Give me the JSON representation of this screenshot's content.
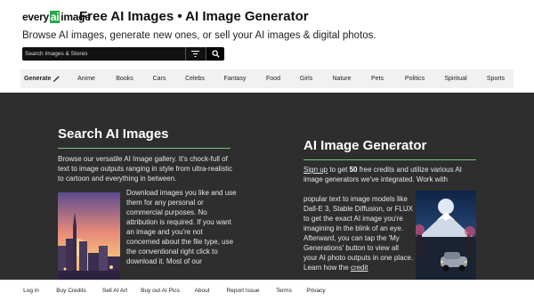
{
  "header": {
    "logo_part1": "every",
    "logo_part2": "ai",
    "logo_part3": "image",
    "title": "Free AI Images • AI Image Generator",
    "tagline": "Browse AI images, generate new ones, or sell your AI images & digital photos."
  },
  "search": {
    "placeholder": "Search Images & Stores",
    "filter_icon": "filter-icon",
    "search_icon": "search-icon"
  },
  "nav": {
    "generate_label": "Generate",
    "generate_icon": "pen-icon",
    "categories": [
      "Anime",
      "Books",
      "Cars",
      "Celebs",
      "Fantasy",
      "Food",
      "Girls",
      "Nature",
      "Pets",
      "Politics",
      "Spiritual",
      "Sports"
    ]
  },
  "left_section": {
    "title": "Search AI Images",
    "paragraph1": "Browse our versatile AI Image gallery. It's chock-full of text to image outputs ranging in style from ultra-realistic to cartoon and everything in between.",
    "paragraph2": "Download images you like and use them for any personal or commercial purposes. No attribution is required. If you want an image and you're not concerned about the file type, use the conventional right click to download it. Most of our"
  },
  "right_section": {
    "title": "AI Image Generator",
    "signup_link": "Sign up",
    "p1_a": " to get ",
    "credits": "50",
    "p1_b": " free credits and utilize various AI image generators we've integrated. Work with",
    "paragraph2_main": "popular text to image models like Dall-E 3, Stable Diffusion, or FLUX to get the exact AI image you're imagining in the blink of an eye. Afterward, you can tap the 'My Generations' button to view all your AI photo outputs in one place. Learn how the ",
    "credit_link": "credit"
  },
  "footer": {
    "links": [
      "Log in",
      "Buy Credits",
      "Sell AI Art",
      "Buy out AI Pics",
      "About",
      "Report Issue",
      "Terms",
      "Privacy"
    ]
  },
  "colors": {
    "accent_green": "#2aa84a",
    "dark_band": "#2e2e2e",
    "nav_bg": "#f1f1f1"
  }
}
